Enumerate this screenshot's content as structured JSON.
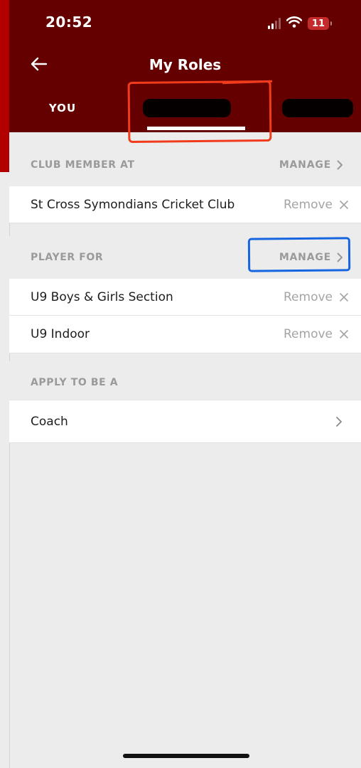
{
  "status_bar": {
    "time": "20:52",
    "battery": "11"
  },
  "header": {
    "title": "My Roles"
  },
  "tabs": [
    {
      "label": "YOU"
    }
  ],
  "sections": {
    "club_member": {
      "title": "CLUB MEMBER AT",
      "manage_label": "MANAGE"
    },
    "player_for": {
      "title": "PLAYER FOR",
      "manage_label": "MANAGE"
    },
    "apply": {
      "title": "APPLY TO BE A"
    }
  },
  "rows": {
    "club": {
      "label": "St Cross Symondians Cricket Club",
      "action": "Remove"
    },
    "u9_boys_girls": {
      "label": "U9 Boys & Girls Section",
      "action": "Remove"
    },
    "u9_indoor": {
      "label": "U9 Indoor",
      "action": "Remove"
    },
    "coach": {
      "label": "Coach"
    }
  },
  "colors": {
    "header_bg": "#650000",
    "annotation_red": "#f03c1c",
    "annotation_blue": "#1565e0"
  }
}
